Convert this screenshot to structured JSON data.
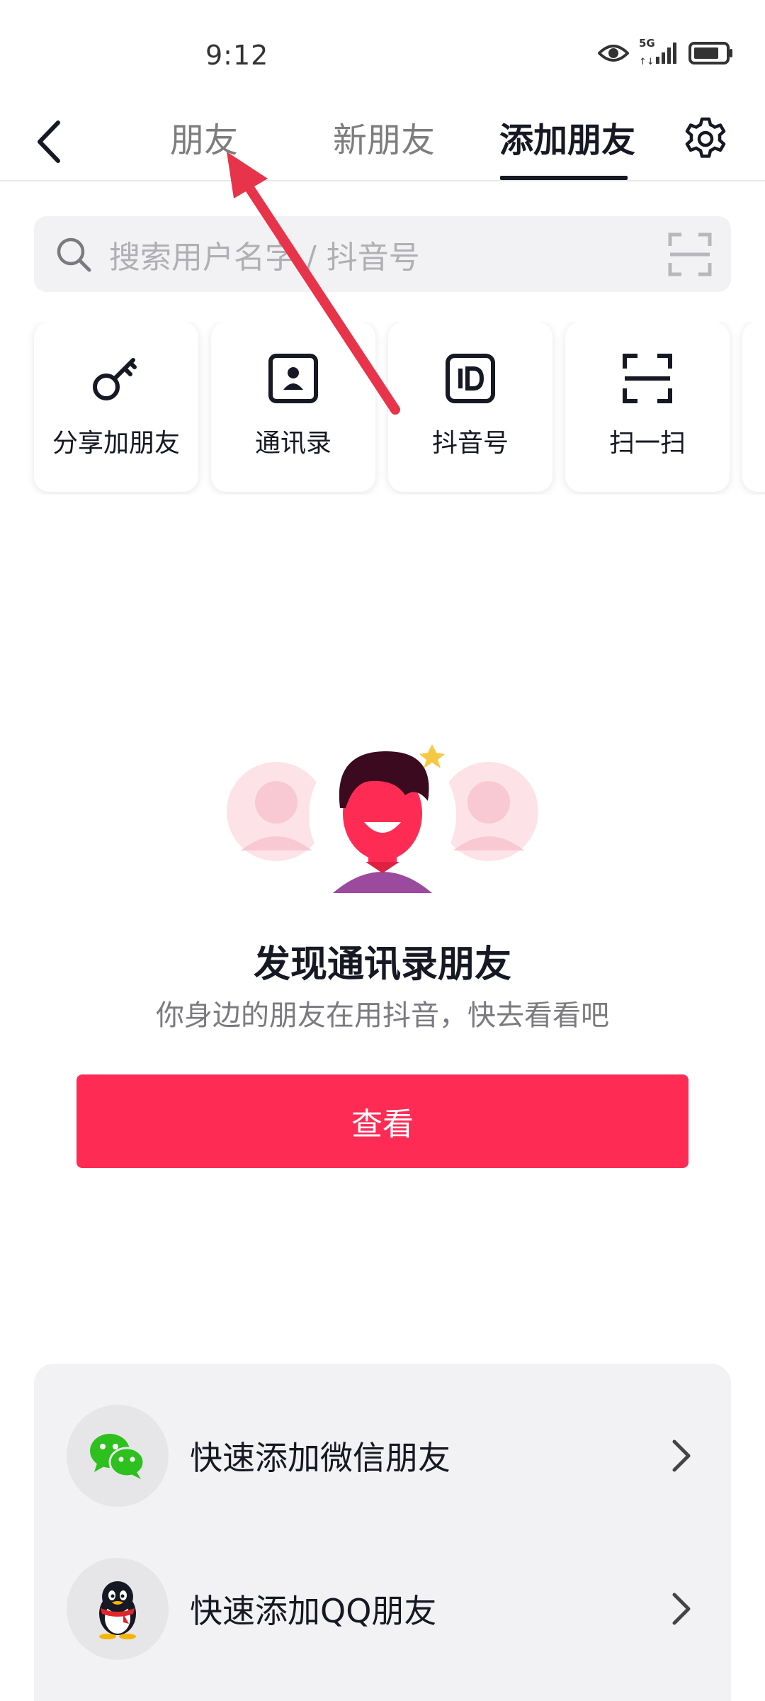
{
  "status_bar": {
    "time": "9:12",
    "network": "5G",
    "icons": [
      "eye-icon",
      "signal-icon",
      "battery-icon"
    ]
  },
  "nav": {
    "back_icon": "chevron-left-icon",
    "tabs": [
      {
        "label": "朋友",
        "active": false
      },
      {
        "label": "新朋友",
        "active": false
      },
      {
        "label": "添加朋友",
        "active": true
      }
    ],
    "settings_icon": "gear-icon"
  },
  "search": {
    "placeholder": "搜索用户名字 / 抖音号",
    "left_icon": "search-icon",
    "right_icon": "scan-icon"
  },
  "quick_actions": [
    {
      "label": "分享加朋友",
      "icon": "key-icon"
    },
    {
      "label": "通讯录",
      "icon": "contacts-icon"
    },
    {
      "label": "抖音号",
      "icon": "id-icon"
    },
    {
      "label": "扫一扫",
      "icon": "scan-icon"
    }
  ],
  "discover": {
    "title": "发现通讯录朋友",
    "subtitle": "你身边的朋友在用抖音，快去看看吧",
    "button_label": "查看"
  },
  "quick_add": [
    {
      "label": "快速添加微信朋友",
      "icon": "wechat-icon"
    },
    {
      "label": "快速添加QQ朋友",
      "icon": "qq-icon"
    }
  ],
  "colors": {
    "accent": "#fe2c55",
    "annotation_arrow": "#e8344a",
    "text_primary": "#161823",
    "text_secondary": "#7a7a7f",
    "panel_bg": "#f2f2f4"
  }
}
